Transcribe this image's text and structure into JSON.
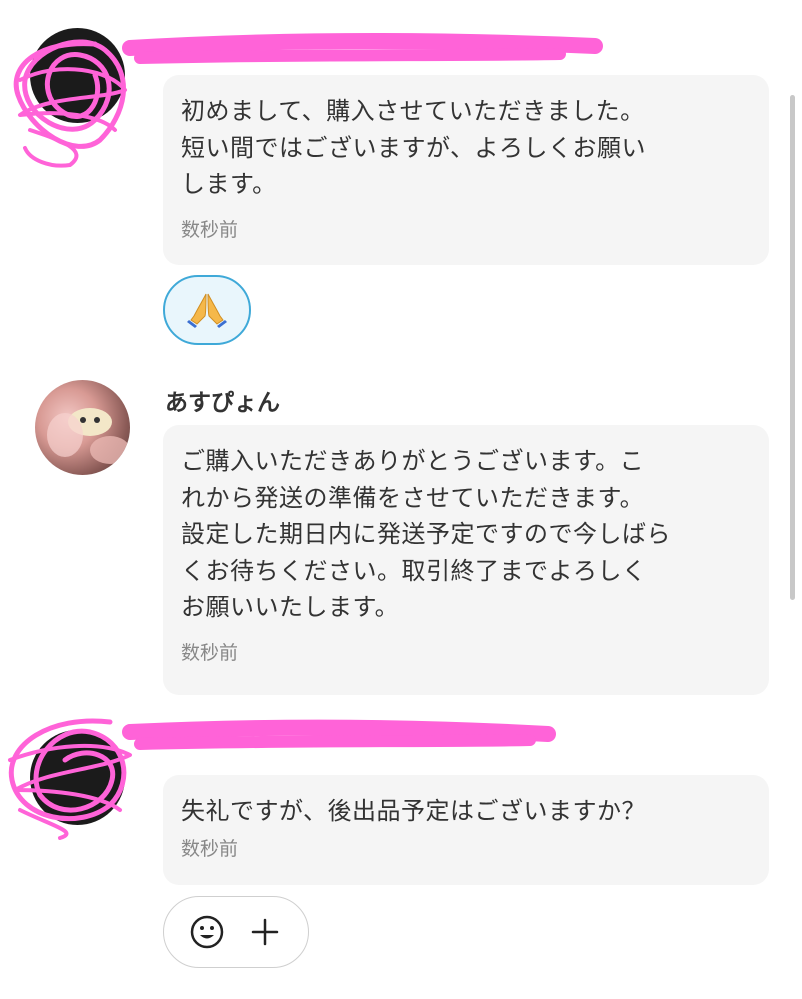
{
  "thread": {
    "messages": [
      {
        "sender": "",
        "text": "初めまして、購入させていただきました。\n短い間ではございますが、よろしくお願い\nします。",
        "time": "数秒前"
      },
      {
        "sender": "あすぴょん",
        "text": "ご購入いただきありがとうございます。こ\nれから発送の準備をさせていただきます。\n設定した期日内に発送予定ですので今しばら\nくお待ちください。取引終了までよろしく\nお願いいたします。",
        "time": "数秒前"
      },
      {
        "sender": "",
        "text": "失礼ですが、後出品予定はございますか？",
        "time": "数秒前"
      }
    ],
    "reaction": {
      "icon": "folded-hands-icon",
      "selected": true
    },
    "reaction_bar": {
      "icons": [
        "smiley-icon",
        "plus-icon"
      ]
    }
  },
  "colors": {
    "bubble": "#f5f5f5",
    "reaction_border": "#3fa9d8",
    "reaction_bg": "#e9f6fc",
    "redaction": "#ff63d8"
  }
}
